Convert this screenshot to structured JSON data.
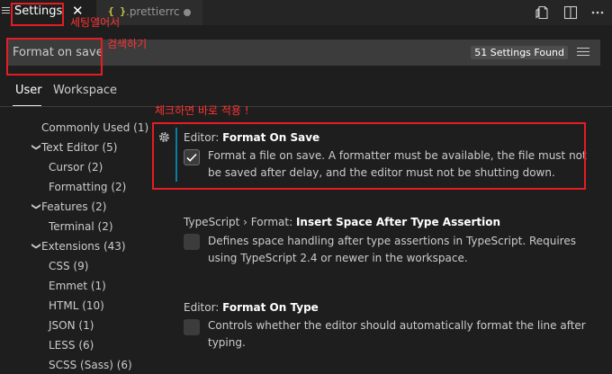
{
  "tabs": {
    "settings_label": "Settings",
    "close_symbol": "✕",
    "file_icon_text": "{ }",
    "file_label": ".prettierrc"
  },
  "annotations": {
    "settings_tab_note": "세팅열어서",
    "search_note": "검색하기",
    "checkbox_note": "체크하면 바로 적용 !"
  },
  "search": {
    "value": "Format on save",
    "found_count": "51 Settings Found"
  },
  "scope_tabs": {
    "user": "User",
    "workspace": "Workspace"
  },
  "toc": [
    {
      "label": "Commonly Used (1)",
      "chevron": ""
    },
    {
      "label": "Text Editor (5)",
      "chevron": "❯"
    },
    {
      "label": "Cursor (2)",
      "chevron": ""
    },
    {
      "label": "Formatting (2)",
      "chevron": ""
    },
    {
      "label": "Features (2)",
      "chevron": "❯"
    },
    {
      "label": "Terminal (2)",
      "chevron": ""
    },
    {
      "label": "Extensions (43)",
      "chevron": "❯"
    },
    {
      "label": "CSS (9)",
      "chevron": ""
    },
    {
      "label": "Emmet (1)",
      "chevron": ""
    },
    {
      "label": "HTML (10)",
      "chevron": ""
    },
    {
      "label": "JSON (1)",
      "chevron": ""
    },
    {
      "label": "LESS (6)",
      "chevron": ""
    },
    {
      "label": "SCSS (Sass) (6)",
      "chevron": ""
    }
  ],
  "settings": [
    {
      "category": "Editor: ",
      "name": "Format On Save",
      "description": "Format a file on save. A formatter must be available, the file must not be saved after delay, and the editor must not be shutting down.",
      "checked": true
    },
    {
      "category": "TypeScript › Format: ",
      "name": "Insert Space After Type Assertion",
      "description": "Defines space handling after type assertions in TypeScript. Requires using TypeScript 2.4 or newer in the workspace.",
      "checked": false
    },
    {
      "category": "Editor: ",
      "name": "Format On Type",
      "description": "Controls whether the editor should automatically format the line after typing.",
      "checked": false
    }
  ],
  "icons": {
    "menu": "menu-icon",
    "json_file": "json-file-icon",
    "open_json": "open-settings-json-icon",
    "split": "split-editor-icon",
    "more": "more-actions-icon",
    "filter": "filter-icon",
    "gear": "gear-icon"
  },
  "colors": {
    "annotation_red": "#e51c23",
    "modified_indicator": "#0c7d9d",
    "json_brace": "#cbcb41"
  }
}
